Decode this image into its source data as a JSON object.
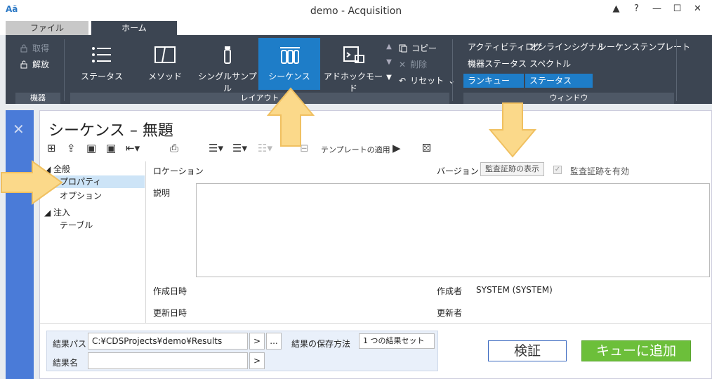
{
  "app": {
    "logo": "Aä",
    "window_title": "demo - Acquisition",
    "controls": {
      "pin": "▲",
      "help": "?",
      "min": "—",
      "max": "☐",
      "close": "✕"
    }
  },
  "tabs": {
    "file": "ファイル",
    "home": "ホーム"
  },
  "ribbon": {
    "device": {
      "acquire": "取得",
      "release": "解放",
      "group": "機器"
    },
    "layout": {
      "status": "ステータス",
      "method": "メソッド",
      "single_sample": "シングルサンプル",
      "sequence": "シーケンス",
      "adhoc": "アドホックモード",
      "copy": "コピー",
      "delete": "削除",
      "reset": "リセット",
      "group": "レイアウト"
    },
    "window": {
      "activity_log": "アクティビティログ",
      "online_signal": "オンラインシグナル",
      "sequence_template": "シーケンステンプレート",
      "device_status": "機器ステータス",
      "spectrum": "スペクトル",
      "run_queue": "ランキュー",
      "status": "ステータス",
      "group": "ウィンドウ"
    }
  },
  "panel": {
    "title": "シーケンス – 無題",
    "toolbar": {
      "apply_template": "テンプレートの適用"
    },
    "tree": {
      "general": "全般",
      "properties": "プロパティ",
      "options": "オプション",
      "injection": "注入",
      "table": "テーブル"
    },
    "form": {
      "location": "ロケーション",
      "version": "バージョン",
      "show_audit": "監査証跡の表示",
      "audit_enable": "監査証跡を有効",
      "description": "説明",
      "created_at": "作成日時",
      "created_by": "作成者",
      "created_by_value": "SYSTEM (SYSTEM)",
      "updated_at": "更新日時",
      "updated_by": "更新者"
    },
    "results": {
      "path_label": "結果パス",
      "path_value": "C:¥CDSProjects¥demo¥Results",
      "name_label": "結果名",
      "save_method_label": "結果の保存方法",
      "save_method_value": "1 つの結果セット",
      "browse": "...",
      "arrow": ">"
    },
    "validate": "検証",
    "add_to_queue": "キューに追加"
  }
}
